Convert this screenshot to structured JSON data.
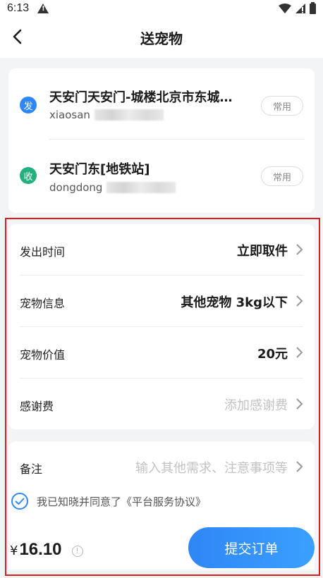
{
  "status_bar": {
    "time": "6:13"
  },
  "nav": {
    "title": "送宠物"
  },
  "sender": {
    "badge": "发",
    "address": "天安门天安门-城楼北京市东城…",
    "contact_name": "xiaosan",
    "tag": "常用"
  },
  "receiver": {
    "badge": "收",
    "address": "天安门东[地铁站]",
    "contact_name": "dongdong",
    "tag": "常用"
  },
  "details": [
    {
      "label": "发出时间",
      "value": "立即取件",
      "placeholder": false
    },
    {
      "label": "宠物信息",
      "value": "其他宠物 3kg以下",
      "placeholder": false
    },
    {
      "label": "宠物价值",
      "value": "20元",
      "placeholder": false
    },
    {
      "label": "感谢费",
      "value": "添加感谢费",
      "placeholder": true
    }
  ],
  "notes": {
    "label": "备注",
    "placeholder": "输入其他需求、注意事项等"
  },
  "agreement": {
    "text": "我已知晓并同意了《平台服务协议》",
    "checked": true
  },
  "total": {
    "currency": "¥",
    "amount": "16.10"
  },
  "submit_label": "提交订单",
  "colors": {
    "accent": "#2f86f6",
    "send_badge": "#2f86f6",
    "recv_badge": "#22b07d",
    "highlight": "#e2191f"
  }
}
